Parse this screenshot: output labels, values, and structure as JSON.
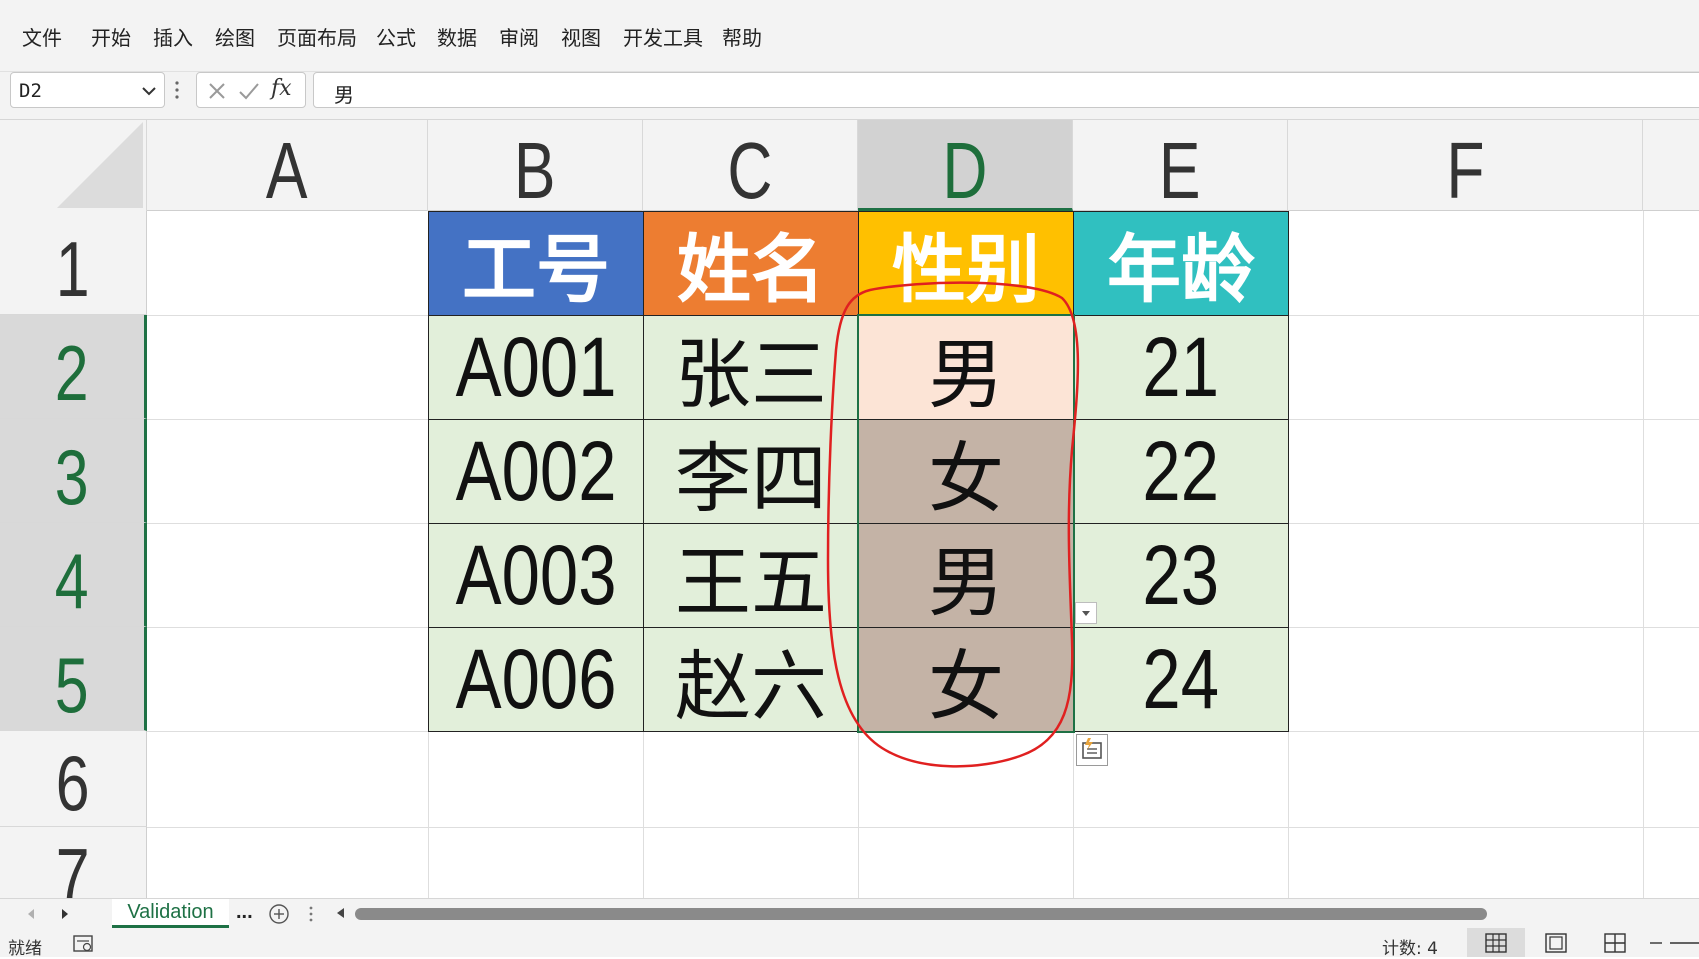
{
  "menu": {
    "items": [
      "文件",
      "开始",
      "插入",
      "绘图",
      "页面布局",
      "公式",
      "数据",
      "审阅",
      "视图",
      "开发工具",
      "帮助"
    ]
  },
  "formula_bar": {
    "name_box": "D2",
    "formula": "男",
    "fx_label": "fx"
  },
  "columns": [
    "A",
    "B",
    "C",
    "D",
    "E",
    "F"
  ],
  "selected_column": "D",
  "rows": [
    "1",
    "2",
    "3",
    "4",
    "5",
    "6",
    "7"
  ],
  "selected_rows": [
    "2",
    "3",
    "4",
    "5"
  ],
  "table": {
    "headers": [
      {
        "text": "工号",
        "color": "#4472c4"
      },
      {
        "text": "姓名",
        "color": "#ed7d31"
      },
      {
        "text": "性别",
        "color": "#ffc000"
      },
      {
        "text": "年龄",
        "color": "#30c0c0"
      }
    ],
    "rows": [
      [
        "A001",
        "张三",
        "男",
        "21"
      ],
      [
        "A002",
        "李四",
        "女",
        "22"
      ],
      [
        "A003",
        "王五",
        "男",
        "23"
      ],
      [
        "A006",
        "赵六",
        "女",
        "24"
      ]
    ],
    "body_color": "#e2efda",
    "active_cell_color": "#fce4d6",
    "selected_range_color": "#c4b3a6"
  },
  "annotation_color": "#e02020",
  "sheet_tabs": {
    "active": "Validation",
    "more": "..."
  },
  "status_bar": {
    "ready": "就绪",
    "count": "计数: 4"
  }
}
